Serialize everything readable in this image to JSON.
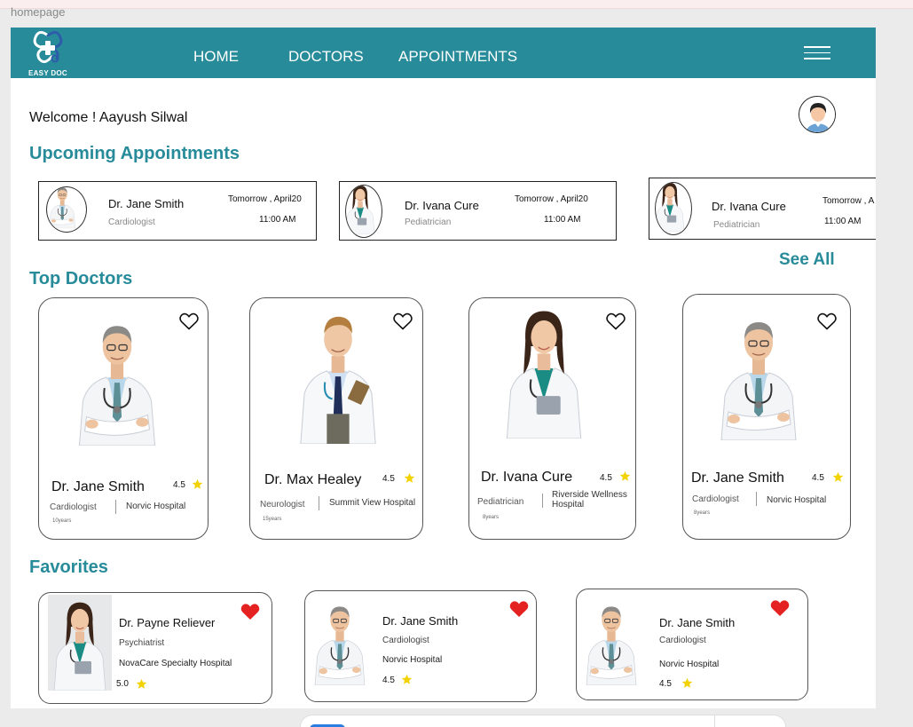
{
  "frame_label": "homepage",
  "app": {
    "logo_text": "EASY DOC",
    "brand_color": "#278b9a"
  },
  "nav": {
    "items": [
      "HOME",
      "DOCTORS",
      "APPOINTMENTS"
    ],
    "menu_icon": "hamburger-menu-icon"
  },
  "welcome": "Welcome ! Aayush Silwal",
  "sections": {
    "upcoming": "Upcoming Appointments",
    "see_all": "See All",
    "top_doctors": "Top  Doctors",
    "favorites": "Favorites"
  },
  "appointments": [
    {
      "name": "Dr. Jane Smith",
      "specialty": "Cardiologist",
      "date": "Tomorrow , April20",
      "time": "11:00 AM"
    },
    {
      "name": "Dr. Ivana Cure",
      "specialty": "Pediatrician",
      "date": "Tomorrow , April20",
      "time": "11:00 AM"
    },
    {
      "name": "Dr. Ivana Cure",
      "specialty": "Pediatrician",
      "date": "Tomorrow , A",
      "time": "11:00 AM"
    }
  ],
  "top_doctors": [
    {
      "name": "Dr. Jane Smith",
      "rating": "4.5",
      "specialty": "Cardiologist",
      "hospital": "Norvic Hospital",
      "experience": "10years"
    },
    {
      "name": "Dr. Max Healey",
      "rating": "4.5",
      "specialty": "Neurologist",
      "hospital": "Summit View Hospital",
      "experience": "15years"
    },
    {
      "name": "Dr. Ivana Cure",
      "rating": "4.5",
      "specialty": "Pediatrician",
      "hospital": "Riverside Wellness Hospital",
      "experience": "8years"
    },
    {
      "name": "Dr. Jane Smith",
      "rating": "4.5",
      "specialty": "Cardiologist",
      "hospital": "Norvic Hospital",
      "experience": "8years"
    }
  ],
  "favorites": [
    {
      "name": "Dr. Payne Reliever",
      "specialty": "Psychiatrist",
      "hospital": "NovaCare Specialty Hospital",
      "rating": "5.0"
    },
    {
      "name": "Dr. Jane Smith",
      "specialty": "Cardiologist",
      "hospital": "Norvic Hospital",
      "rating": "4.5"
    },
    {
      "name": "Dr. Jane Smith",
      "specialty": "Cardiologist",
      "hospital": "Norvic Hospital",
      "rating": "4.5"
    }
  ],
  "colors": {
    "accent": "#278b9a",
    "star": "#f2d200",
    "favorite_heart": "#e52222"
  }
}
